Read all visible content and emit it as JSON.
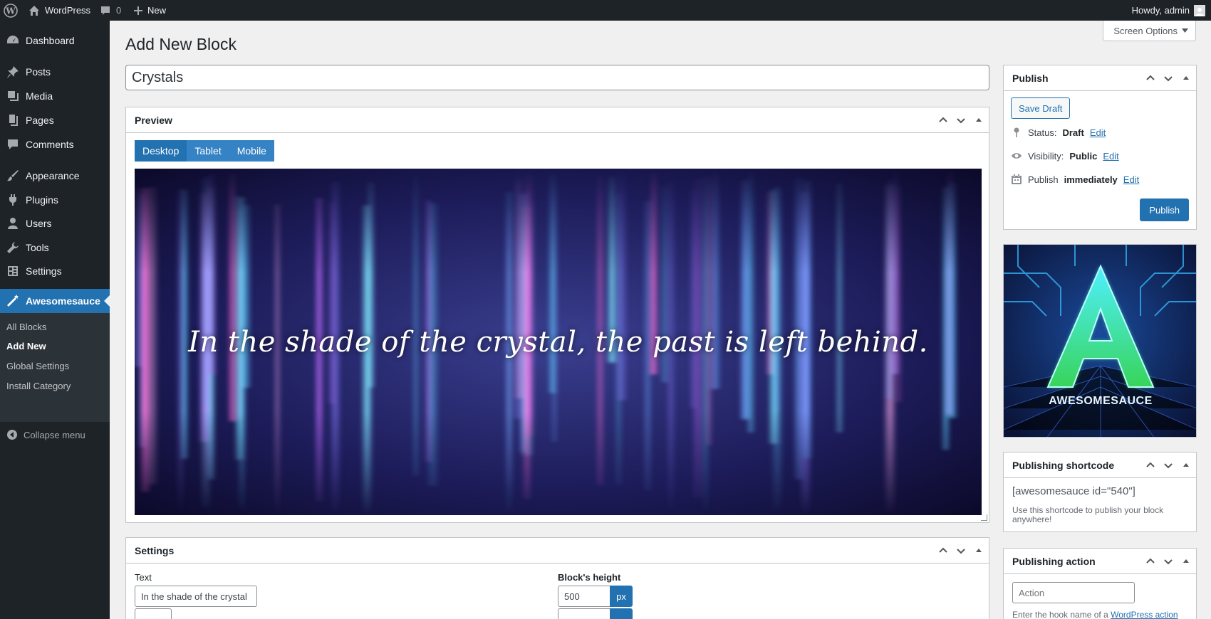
{
  "adminbar": {
    "site_name": "WordPress",
    "comments_count": "0",
    "new_label": "New",
    "howdy": "Howdy, admin"
  },
  "menu": {
    "items": [
      {
        "label": "Dashboard",
        "icon": "dashboard-icon"
      },
      {
        "label": "Posts",
        "icon": "pin-icon"
      },
      {
        "label": "Media",
        "icon": "media-icon"
      },
      {
        "label": "Pages",
        "icon": "pages-icon"
      },
      {
        "label": "Comments",
        "icon": "comment-icon"
      },
      {
        "label": "Appearance",
        "icon": "brush-icon"
      },
      {
        "label": "Plugins",
        "icon": "plug-icon"
      },
      {
        "label": "Users",
        "icon": "user-icon"
      },
      {
        "label": "Tools",
        "icon": "wrench-icon"
      },
      {
        "label": "Settings",
        "icon": "settings-icon"
      },
      {
        "label": "Awesomesauce",
        "icon": "magic-wand-icon"
      }
    ],
    "submenu": [
      "All Blocks",
      "Add New",
      "Global Settings",
      "Install Category"
    ],
    "collapse_label": "Collapse menu"
  },
  "screen_options": "Screen Options",
  "page_title": "Add New Block",
  "post_title": "Crystals",
  "preview": {
    "heading": "Preview",
    "tabs": [
      "Desktop",
      "Tablet",
      "Mobile"
    ],
    "active_tab": "Desktop",
    "text": "In the shade of the crystal, the past is left behind."
  },
  "settings": {
    "heading": "Settings",
    "text_label": "Text",
    "text_value": "In the shade of the crystal",
    "height_label": "Block's height",
    "height_value": "500",
    "height_unit": "px"
  },
  "publish": {
    "heading": "Publish",
    "save_draft": "Save Draft",
    "status_label": "Status:",
    "status_value": "Draft",
    "visibility_label": "Visibility:",
    "visibility_value": "Public",
    "publish_label": "Publish",
    "publish_value": "immediately",
    "edit_link": "Edit",
    "publish_button": "Publish"
  },
  "logo": {
    "text": "AWESOMESAUCE",
    "letter": "A"
  },
  "shortcode_box": {
    "heading": "Publishing shortcode",
    "shortcode": "[awesomesauce id=\"540\"]",
    "hint": "Use this shortcode to publish your block anywhere!"
  },
  "action_box": {
    "heading": "Publishing action",
    "placeholder": "Action",
    "hint_prefix": "Enter the hook name of a",
    "hint_link": "WordPress action"
  },
  "colors": {
    "accent": "#2271b1",
    "admin_bar": "#1d2327",
    "background": "#f0f0f1"
  }
}
